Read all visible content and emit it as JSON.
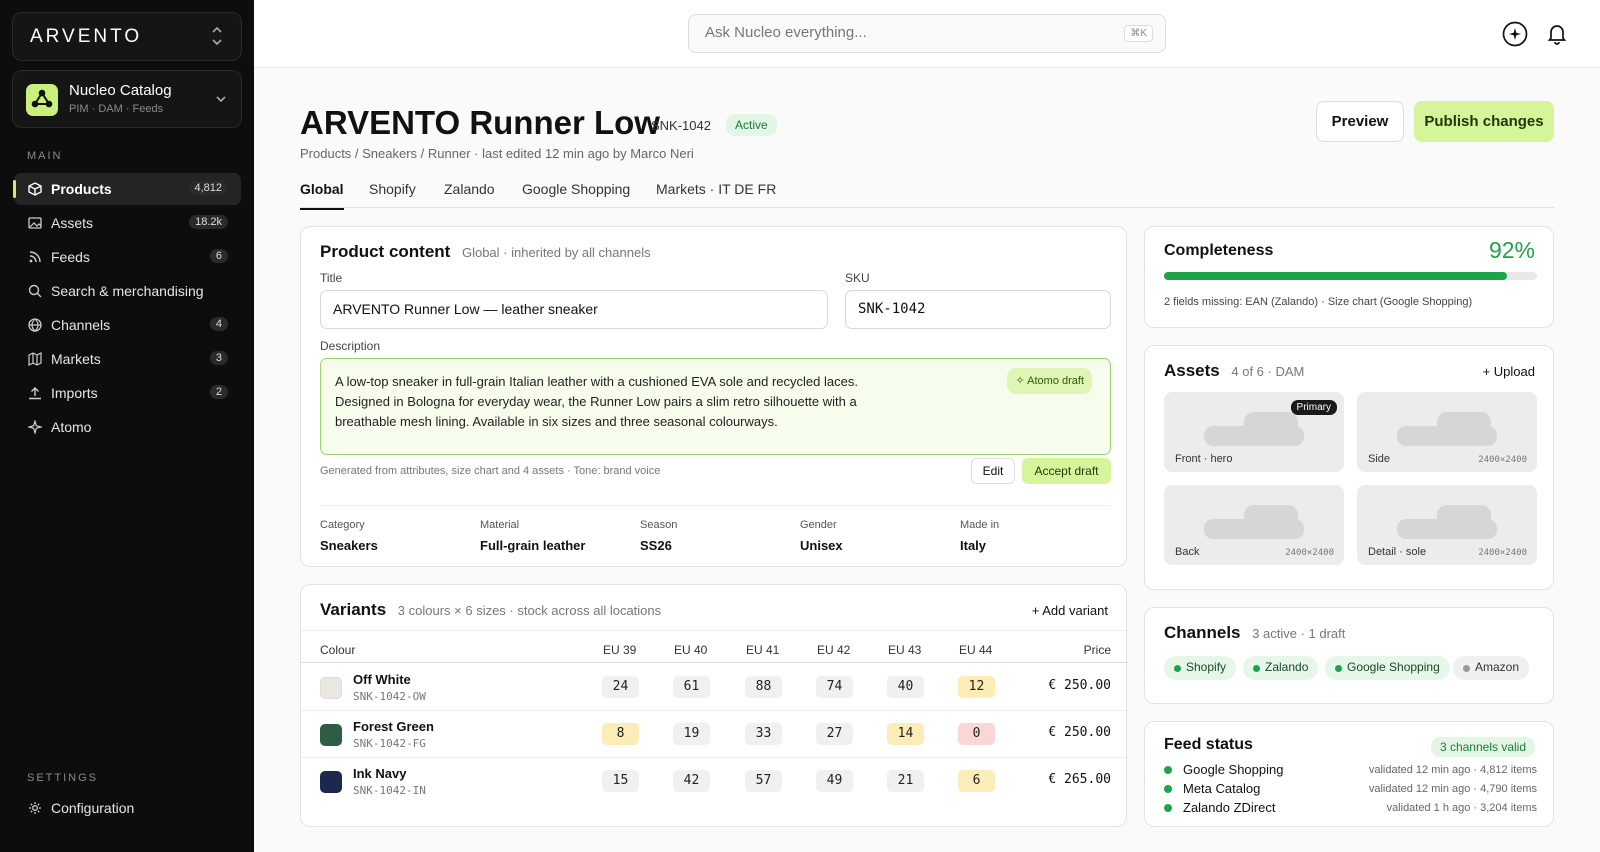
{
  "sidebar": {
    "org_name": "ARVENTO",
    "catalog": {
      "name": "Nucleo Catalog",
      "subtitle": "PIM · DAM · Feeds"
    },
    "main_label": "MAIN",
    "items": [
      {
        "label": "Products",
        "count": "4,812",
        "icon": "cube-icon",
        "active": true
      },
      {
        "label": "Assets",
        "count": "18.2k",
        "icon": "image-icon"
      },
      {
        "label": "Feeds",
        "count": "6",
        "icon": "rss-icon"
      },
      {
        "label": "Search & merchandising",
        "count": "",
        "icon": "search-icon"
      },
      {
        "label": "Channels",
        "count": "4",
        "icon": "globe-icon"
      },
      {
        "label": "Markets",
        "count": "3",
        "icon": "map-icon"
      },
      {
        "label": "Imports",
        "count": "2",
        "icon": "upload-icon"
      },
      {
        "label": "Atomo",
        "count": "",
        "icon": "sparkle-icon"
      }
    ],
    "settings_label": "SETTINGS",
    "settings_item": "Configuration"
  },
  "topbar": {
    "search_placeholder": "Ask Nucleo everything...",
    "shortcut": "⌘K"
  },
  "product": {
    "title": "ARVENTO Runner Low",
    "sku": "SNK-1042",
    "status": "Active",
    "breadcrumb": "Products / Sneakers / Runner · last edited 12 min ago by Marco Neri"
  },
  "actions": {
    "preview": "Preview",
    "publish": "Publish changes"
  },
  "tabs": [
    "Global",
    "Shopify",
    "Zalando",
    "Google Shopping",
    "Markets · IT DE FR"
  ],
  "content": {
    "title": "Product content",
    "subtitle": "Global · inherited by all channels",
    "title_label": "Title",
    "title_value": "ARVENTO Runner Low — leather sneaker",
    "sku_label": "SKU",
    "sku_value": "SNK-1042",
    "desc_label": "Description",
    "desc_value": "A low-top sneaker in full-grain Italian leather with a cushioned EVA sole and recycled laces. Designed in Bologna for everyday wear, the Runner Low pairs a slim retro silhouette with a breathable mesh lining. Available in six sizes and three seasonal colourways.",
    "draft_badge": "Atomo draft",
    "generated_note": "Generated from attributes, size chart and 4 assets · Tone: brand voice",
    "edit": "Edit",
    "accept": "Accept draft",
    "attributes": [
      {
        "k": "Category",
        "v": "Sneakers"
      },
      {
        "k": "Material",
        "v": "Full-grain leather"
      },
      {
        "k": "Season",
        "v": "SS26"
      },
      {
        "k": "Gender",
        "v": "Unisex"
      },
      {
        "k": "Made in",
        "v": "Italy"
      }
    ]
  },
  "variants": {
    "title": "Variants",
    "subtitle": "3 colours × 6 sizes · stock across all locations",
    "add": "+ Add variant",
    "columns": [
      "Colour",
      "EU 39",
      "EU 40",
      "EU 41",
      "EU 42",
      "EU 43",
      "EU 44",
      "Price"
    ],
    "rows": [
      {
        "name": "Off White",
        "sku": "SNK-1042-OW",
        "color": "#ebe8e2",
        "stock": [
          "24",
          "61",
          "88",
          "74",
          "40",
          "12"
        ],
        "levels": [
          "",
          "",
          "",
          "",
          "",
          "low"
        ],
        "price": "€ 250.00"
      },
      {
        "name": "Forest Green",
        "sku": "SNK-1042-FG",
        "color": "#2e5c45",
        "stock": [
          "8",
          "19",
          "33",
          "27",
          "14",
          "0"
        ],
        "levels": [
          "low",
          "",
          "",
          "",
          "low",
          "out"
        ],
        "price": "€ 250.00"
      },
      {
        "name": "Ink Navy",
        "sku": "SNK-1042-IN",
        "color": "#1d2850",
        "stock": [
          "15",
          "42",
          "57",
          "49",
          "21",
          "6"
        ],
        "levels": [
          "",
          "",
          "",
          "",
          "",
          "low"
        ],
        "price": "€ 265.00"
      }
    ]
  },
  "completeness": {
    "title": "Completeness",
    "percent": "92%",
    "fraction": 0.92,
    "note": "2 fields missing: EAN (Zalando) · Size chart (Google Shopping)"
  },
  "assets": {
    "title": "Assets",
    "subtitle": "4 of 6 · DAM",
    "upload": "+ Upload",
    "primary": "Primary",
    "items": [
      {
        "label": "Front · hero",
        "dims": ""
      },
      {
        "label": "Side",
        "dims": "2400×2400"
      },
      {
        "label": "Back",
        "dims": "2400×2400"
      },
      {
        "label": "Detail · sole",
        "dims": "2400×2400"
      }
    ]
  },
  "channels": {
    "title": "Channels",
    "subtitle": "3 active · 1 draft",
    "items": [
      {
        "name": "Shopify",
        "active": true
      },
      {
        "name": "Zalando",
        "active": true
      },
      {
        "name": "Google Shopping",
        "active": true
      },
      {
        "name": "Amazon",
        "active": false
      }
    ]
  },
  "feeds": {
    "title": "Feed status",
    "badge": "3 channels valid",
    "items": [
      {
        "name": "Google Shopping",
        "meta": "validated 12 min ago · 4,812 items"
      },
      {
        "name": "Meta Catalog",
        "meta": "validated 12 min ago · 4,790 items"
      },
      {
        "name": "Zalando ZDirect",
        "meta": "validated 1 h ago · 3,204 items"
      }
    ]
  },
  "colors": {
    "accent": "#d6f59a",
    "success": "#1fa34a",
    "sidebar_bg": "#0d0d0d"
  }
}
